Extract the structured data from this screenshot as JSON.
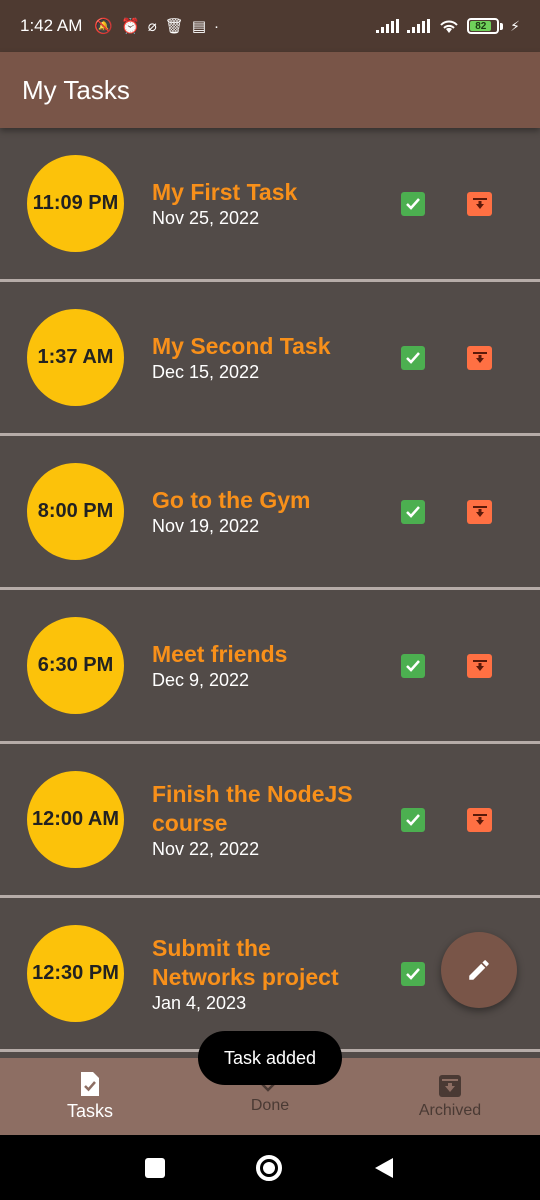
{
  "status_bar": {
    "time": "1:42 AM",
    "battery": "82"
  },
  "app_bar": {
    "title": "My Tasks"
  },
  "tasks": [
    {
      "time": "11:09 PM",
      "title": "My First Task",
      "date": "Nov 25, 2022"
    },
    {
      "time": "1:37 AM",
      "title": "My Second Task",
      "date": "Dec 15, 2022"
    },
    {
      "time": "8:00 PM",
      "title": "Go to the Gym",
      "date": "Nov 19, 2022"
    },
    {
      "time": "6:30 PM",
      "title": "Meet friends",
      "date": "Dec 9, 2022"
    },
    {
      "time": "12:00 AM",
      "title": "Finish the NodeJS course",
      "date": "Nov 22, 2022"
    },
    {
      "time": "12:30 PM",
      "title": "Submit the Networks project",
      "date": "Jan 4, 2023"
    }
  ],
  "bottom_nav": {
    "tasks": "Tasks",
    "done": "Done",
    "archived": "Archived"
  },
  "snackbar": "Task added",
  "colors": {
    "app_bar": "#795548",
    "time_circle": "#fcc20a",
    "title": "#f8901a",
    "done": "#4caf50",
    "archive": "#ff7043",
    "bottom_nav": "#8d6e63"
  }
}
